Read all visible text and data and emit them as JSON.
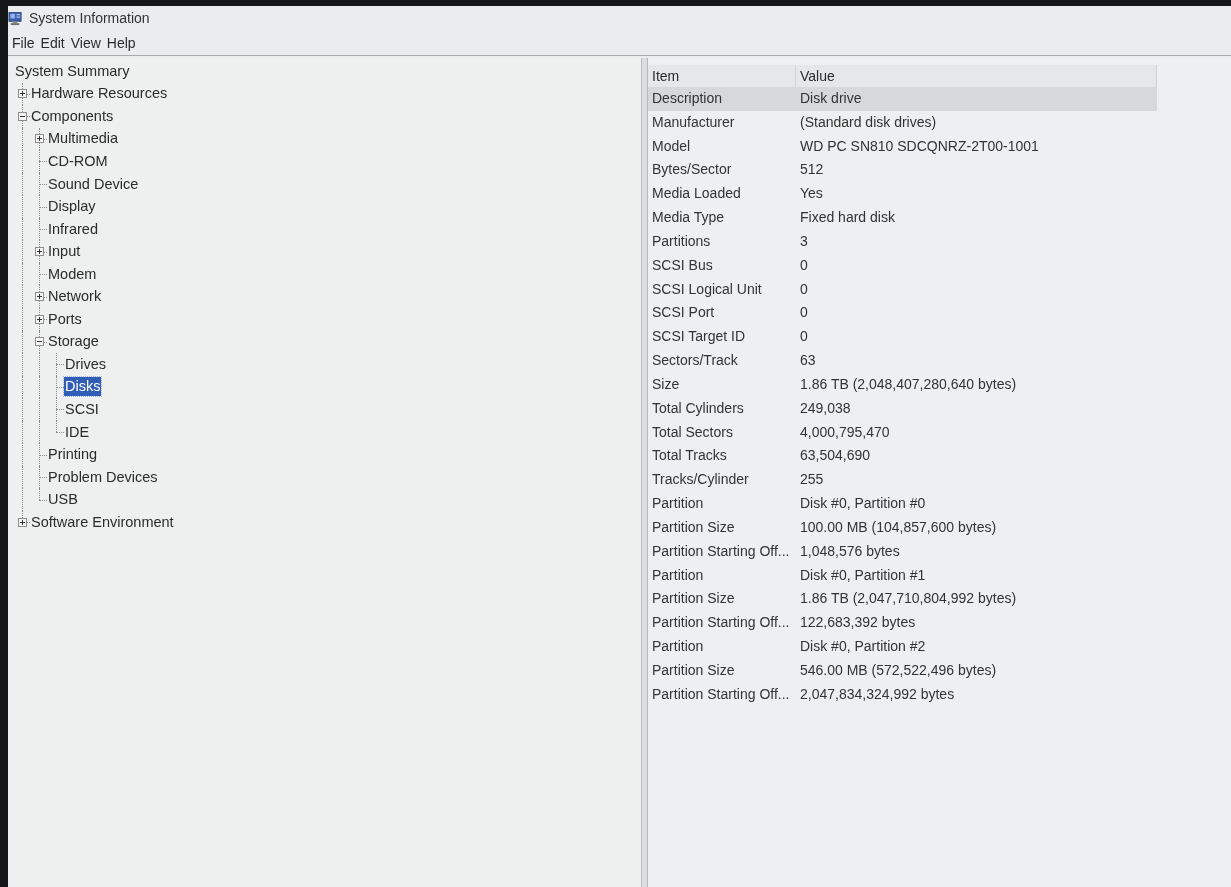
{
  "window": {
    "title": "System Information"
  },
  "menu": [
    "File",
    "Edit",
    "View",
    "Help"
  ],
  "tree": [
    {
      "label": "System Summary",
      "selected": false,
      "children": [
        {
          "label": "Hardware Resources",
          "expanded": false,
          "selected": false
        },
        {
          "label": "Components",
          "expanded": true,
          "selected": false,
          "children": [
            {
              "label": "Multimedia",
              "expanded": false,
              "selected": false
            },
            {
              "label": "CD-ROM",
              "selected": false
            },
            {
              "label": "Sound Device",
              "selected": false
            },
            {
              "label": "Display",
              "selected": false
            },
            {
              "label": "Infrared",
              "selected": false
            },
            {
              "label": "Input",
              "expanded": false,
              "selected": false
            },
            {
              "label": "Modem",
              "selected": false
            },
            {
              "label": "Network",
              "expanded": false,
              "selected": false
            },
            {
              "label": "Ports",
              "expanded": false,
              "selected": false
            },
            {
              "label": "Storage",
              "expanded": true,
              "selected": false,
              "children": [
                {
                  "label": "Drives",
                  "selected": false
                },
                {
                  "label": "Disks",
                  "selected": true
                },
                {
                  "label": "SCSI",
                  "selected": false
                },
                {
                  "label": "IDE",
                  "selected": false
                }
              ]
            },
            {
              "label": "Printing",
              "selected": false
            },
            {
              "label": "Problem Devices",
              "selected": false
            },
            {
              "label": "USB",
              "selected": false
            }
          ]
        },
        {
          "label": "Software Environment",
          "expanded": false,
          "selected": false
        }
      ]
    }
  ],
  "table": {
    "columns": [
      "Item",
      "Value"
    ],
    "rows": [
      {
        "item": "Description",
        "value": "Disk drive",
        "selected": true
      },
      {
        "item": "Manufacturer",
        "value": "(Standard disk drives)",
        "selected": false
      },
      {
        "item": "Model",
        "value": "WD PC SN810 SDCQNRZ-2T00-1001",
        "selected": false
      },
      {
        "item": "Bytes/Sector",
        "value": "512",
        "selected": false
      },
      {
        "item": "Media Loaded",
        "value": "Yes",
        "selected": false
      },
      {
        "item": "Media Type",
        "value": "Fixed hard disk",
        "selected": false
      },
      {
        "item": "Partitions",
        "value": "3",
        "selected": false
      },
      {
        "item": "SCSI Bus",
        "value": "0",
        "selected": false
      },
      {
        "item": "SCSI Logical Unit",
        "value": "0",
        "selected": false
      },
      {
        "item": "SCSI Port",
        "value": "0",
        "selected": false
      },
      {
        "item": "SCSI Target ID",
        "value": "0",
        "selected": false
      },
      {
        "item": "Sectors/Track",
        "value": "63",
        "selected": false
      },
      {
        "item": "Size",
        "value": "1.86 TB (2,048,407,280,640 bytes)",
        "selected": false
      },
      {
        "item": "Total Cylinders",
        "value": "249,038",
        "selected": false
      },
      {
        "item": "Total Sectors",
        "value": "4,000,795,470",
        "selected": false
      },
      {
        "item": "Total Tracks",
        "value": "63,504,690",
        "selected": false
      },
      {
        "item": "Tracks/Cylinder",
        "value": "255",
        "selected": false
      },
      {
        "item": "Partition",
        "value": "Disk #0, Partition #0",
        "selected": false
      },
      {
        "item": "Partition Size",
        "value": "100.00 MB (104,857,600 bytes)",
        "selected": false
      },
      {
        "item": "Partition Starting Off...",
        "value": "1,048,576 bytes",
        "selected": false
      },
      {
        "item": "Partition",
        "value": "Disk #0, Partition #1",
        "selected": false
      },
      {
        "item": "Partition Size",
        "value": "1.86 TB (2,047,710,804,992 bytes)",
        "selected": false
      },
      {
        "item": "Partition Starting Off...",
        "value": "122,683,392 bytes",
        "selected": false
      },
      {
        "item": "Partition",
        "value": "Disk #0, Partition #2",
        "selected": false
      },
      {
        "item": "Partition Size",
        "value": "546.00 MB (572,522,496 bytes)",
        "selected": false
      },
      {
        "item": "Partition Starting Off...",
        "value": "2,047,834,324,992 bytes",
        "selected": false
      }
    ]
  }
}
